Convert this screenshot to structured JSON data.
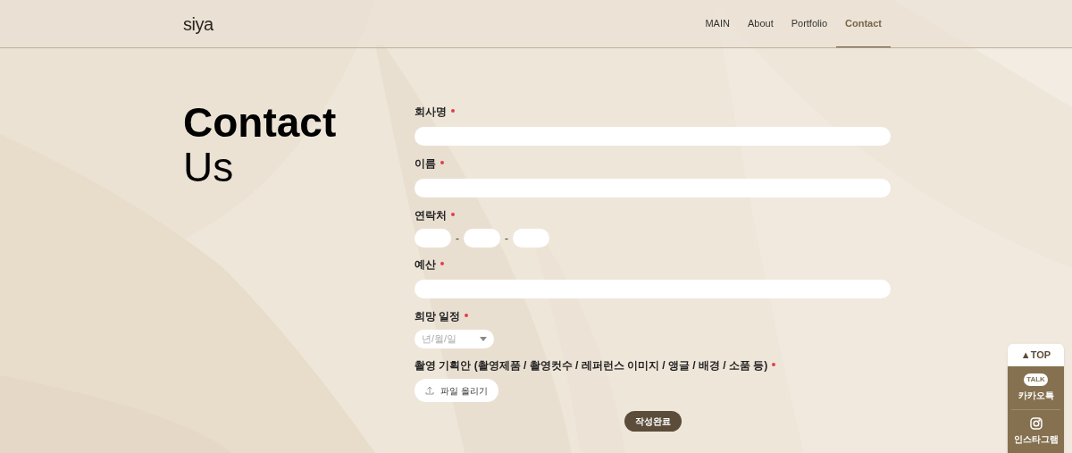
{
  "header": {
    "logo": "siya",
    "nav": [
      {
        "label": "MAIN",
        "selected": false
      },
      {
        "label": "About",
        "selected": false
      },
      {
        "label": "Portfolio",
        "selected": false
      },
      {
        "label": "Contact",
        "selected": true
      }
    ]
  },
  "heading": {
    "line_1": "Contact",
    "line_2": "Us"
  },
  "form": {
    "fields": [
      {
        "kind": "text",
        "label": "회사명",
        "required": true
      },
      {
        "kind": "text",
        "label": "이름",
        "required": true
      },
      {
        "kind": "phone",
        "label": "연락처",
        "required": true,
        "separators": [
          "-",
          "-"
        ]
      },
      {
        "kind": "text",
        "label": "예산",
        "required": true
      },
      {
        "kind": "date",
        "label": "희망 일정",
        "required": true,
        "placeholder": "년/월/일"
      },
      {
        "kind": "file",
        "label": "촬영 기획안 (촬영제품 / 촬영컷수 / 레퍼런스 이미지 / 앵글 / 배경 / 소품 등)",
        "required": true,
        "button": "파일 올리기"
      }
    ],
    "submit": "작성완료"
  },
  "quick_menu": {
    "top": "▲TOP",
    "items": [
      {
        "kind": "kakao",
        "label": "카카오톡",
        "icon_text": "TALK"
      },
      {
        "kind": "instagram",
        "label": "인스타그램"
      }
    ]
  }
}
